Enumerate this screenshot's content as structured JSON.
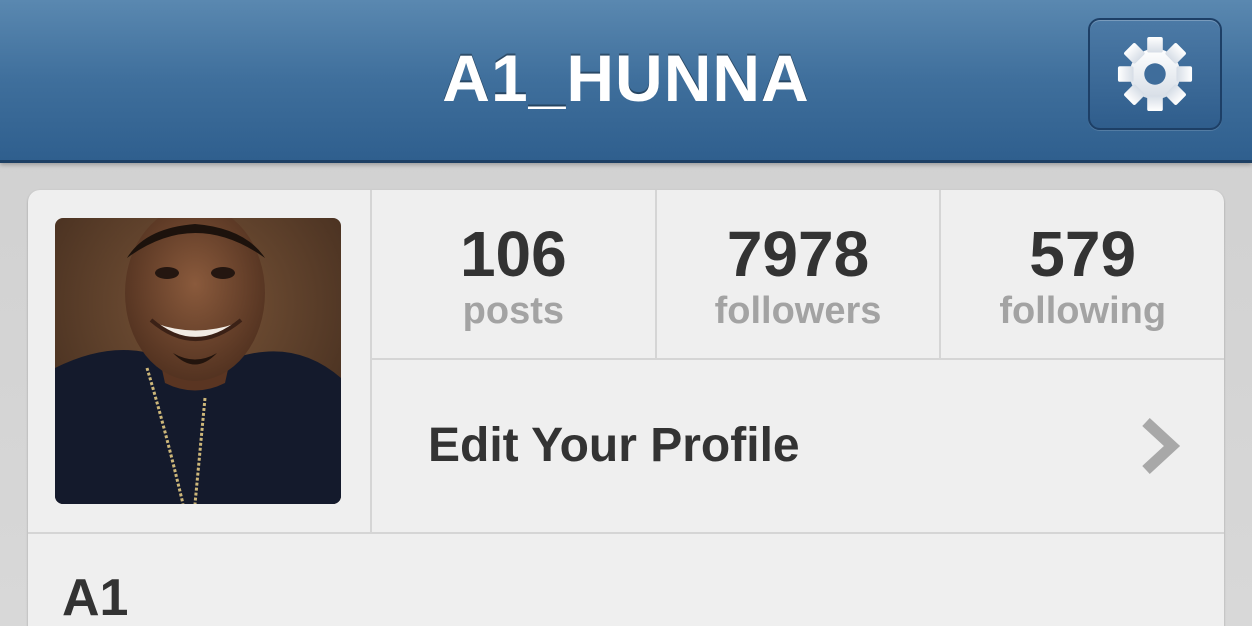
{
  "header": {
    "title": "A1_HUNNA",
    "settings_icon": "gear-icon"
  },
  "profile": {
    "stats": [
      {
        "value": "106",
        "label": "posts"
      },
      {
        "value": "7978",
        "label": "followers"
      },
      {
        "value": "579",
        "label": "following"
      }
    ],
    "edit_label": "Edit Your Profile",
    "name": "A1"
  },
  "colors": {
    "navbar": "#3f6f9c",
    "card_background": "#efefef",
    "stat_label": "#a3a3a3"
  }
}
